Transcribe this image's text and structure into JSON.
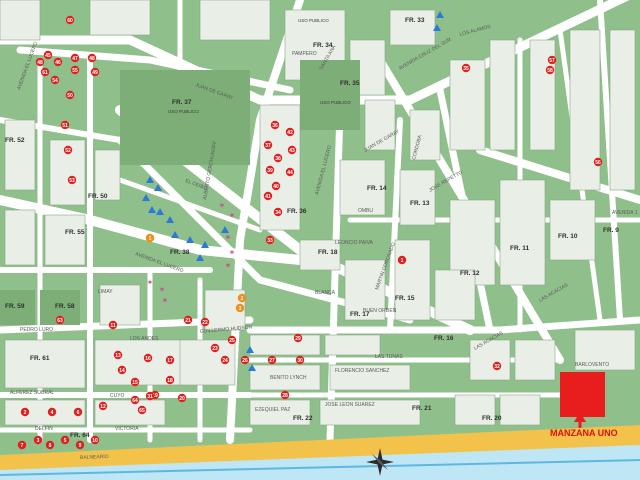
{
  "map": {
    "colors": {
      "block": "#8fbf8a",
      "block_dark": "#7aa874",
      "street": "#ffffff",
      "lot_fill": "#e9efe6",
      "lot_line": "#8aa58a",
      "park": "#7dae78",
      "beach": "#f3c24a",
      "sea": "#bfe6f4",
      "sea_dark": "#5fb7e0",
      "marker_red": "#e0201e",
      "marker_blue": "#2d7ad6",
      "marker_orange": "#f28c1e",
      "marker_pink": "#d1468e",
      "highlight": "#e81e1e"
    },
    "streets": {
      "juan_de_garay_1": "JUAN DE GARAY",
      "juan_de_garay_2": "JUAN DE GARAY",
      "los_alamos": "LOS ALAMOS",
      "avenida_cruz_del_sur": "AVENIDA CRUZ DEL SUR",
      "pampero": "PAMPERO",
      "santa_ana": "SANTA ANA",
      "el_ceibo": "EL CEIBO",
      "avenida_el_lucero_1": "AVENIDA EL LUCERO",
      "avenida_el_lucero_2": "AVENIDA EL LUCERO",
      "avenida_el_lucero_3": "AVENIDA EL LUCERO",
      "leoncio_paiva": "LEONCIO PAIVA",
      "blanca": "BLANCA",
      "pedro_luro": "PEDRO LURO",
      "los_andes": "LOS ANDES",
      "limay": "LIMAY",
      "cuyo": "CUYO",
      "victoria": "VICTORIA",
      "alferez_sobral": "ALFEREZ SOBRAL",
      "delfin": "DELFIN",
      "balneario": "BALNEARIO",
      "guillermo_hudson": "GUILLERMO HUDSON",
      "las_tunas": "LAS TUNAS",
      "florencio_sanchez": "FLORENCIO SANCHEZ",
      "benito_lynch": "BENITO LYNCH",
      "jose_leon_suarez": "JOSE LEON SUAREZ",
      "ezequiel_paz": "EZEQUIEL PAZ",
      "las_acacias_1": "LAS ACACIAS",
      "las_acacias_2": "LAS ACACIAS",
      "barlovento": "BARLOVENTO",
      "jose_repetto": "JOSE REPETTO",
      "cordoba": "CORDOBA",
      "ombu": "OMBU",
      "avenida_1": "AVENIDA 1",
      "alberto_gerchunoff": "ALBERTO GERCHUNOFF",
      "buen_orden": "BUEN ORDEN",
      "martin_coronado": "MARTIN CORONADO"
    },
    "blocks": {
      "fr37": "FR. 37",
      "fr37_sub": "USO PUBLICO",
      "uso_publico_top": "USO PUBLICO",
      "fr34": "FR. 34",
      "fr35": "FR. 35",
      "fr35_sub": "USO PUBLICO",
      "fr33": "FR. 33",
      "fr36": "FR. 36",
      "fr38": "FR. 38",
      "fr18": "FR. 18",
      "fr17": "FR. 17",
      "fr14": "FR. 14",
      "fr13": "FR. 13",
      "fr12": "FR. 12",
      "fr11": "FR. 11",
      "fr10": "FR. 10",
      "fr9": "FR. 9",
      "fr15": "FR. 15",
      "fr16": "FR. 16",
      "fr59": "FR. 59",
      "fr58": "FR. 58",
      "fr61": "FR. 61",
      "fr64": "FR. 64",
      "fr55": "FR. 55",
      "fr52": "FR. 52",
      "fr50": "FR. 50",
      "fr22": "FR. 22",
      "fr21": "FR. 21",
      "fr20": "FR. 20"
    },
    "label_manzana": "MANZANA UNO",
    "markers": [
      {
        "n": "45",
        "c": "red"
      },
      {
        "n": "46",
        "c": "red"
      },
      {
        "n": "47",
        "c": "red"
      },
      {
        "n": "48",
        "c": "red"
      },
      {
        "n": "48",
        "c": "red"
      },
      {
        "n": "49",
        "c": "red"
      },
      {
        "n": "50",
        "c": "red"
      },
      {
        "n": "51",
        "c": "red"
      },
      {
        "n": "52",
        "c": "red"
      },
      {
        "n": "53",
        "c": "red"
      },
      {
        "n": "54",
        "c": "red"
      },
      {
        "n": "55",
        "c": "red"
      },
      {
        "n": "36",
        "c": "red"
      },
      {
        "n": "37",
        "c": "red"
      },
      {
        "n": "38",
        "c": "red"
      },
      {
        "n": "39",
        "c": "red"
      },
      {
        "n": "40",
        "c": "red"
      },
      {
        "n": "41",
        "c": "red"
      },
      {
        "n": "42",
        "c": "red"
      },
      {
        "n": "43",
        "c": "red"
      },
      {
        "n": "44",
        "c": "red"
      },
      {
        "n": "33",
        "c": "red"
      },
      {
        "n": "34",
        "c": "red"
      },
      {
        "n": "35",
        "c": "red"
      },
      {
        "n": "1",
        "c": "red"
      },
      {
        "n": "2",
        "c": "red"
      },
      {
        "n": "3",
        "c": "red"
      },
      {
        "n": "4",
        "c": "red"
      },
      {
        "n": "5",
        "c": "red"
      },
      {
        "n": "6",
        "c": "red"
      },
      {
        "n": "7",
        "c": "red"
      },
      {
        "n": "8",
        "c": "red"
      },
      {
        "n": "9",
        "c": "red"
      },
      {
        "n": "10",
        "c": "red"
      },
      {
        "n": "11",
        "c": "red"
      },
      {
        "n": "12",
        "c": "red"
      },
      {
        "n": "13",
        "c": "red"
      },
      {
        "n": "14",
        "c": "red"
      },
      {
        "n": "15",
        "c": "red"
      },
      {
        "n": "16",
        "c": "red"
      },
      {
        "n": "17",
        "c": "red"
      },
      {
        "n": "18",
        "c": "red"
      },
      {
        "n": "19",
        "c": "red"
      },
      {
        "n": "20",
        "c": "red"
      },
      {
        "n": "21",
        "c": "red"
      },
      {
        "n": "22",
        "c": "red"
      },
      {
        "n": "23",
        "c": "red"
      },
      {
        "n": "24",
        "c": "red"
      },
      {
        "n": "25",
        "c": "red"
      },
      {
        "n": "26",
        "c": "red"
      },
      {
        "n": "27",
        "c": "red"
      },
      {
        "n": "28",
        "c": "red"
      },
      {
        "n": "29",
        "c": "red"
      },
      {
        "n": "30",
        "c": "red"
      },
      {
        "n": "31",
        "c": "red"
      },
      {
        "n": "32",
        "c": "red"
      },
      {
        "n": "56",
        "c": "red"
      },
      {
        "n": "57",
        "c": "red"
      },
      {
        "n": "58",
        "c": "red"
      },
      {
        "n": "60",
        "c": "red"
      },
      {
        "n": "61",
        "c": "red"
      },
      {
        "n": "63",
        "c": "red"
      },
      {
        "n": "64",
        "c": "red"
      },
      {
        "n": "65",
        "c": "red"
      },
      {
        "n": "1",
        "c": "orange"
      },
      {
        "n": "2",
        "c": "orange"
      },
      {
        "n": "3",
        "c": "orange"
      }
    ]
  }
}
